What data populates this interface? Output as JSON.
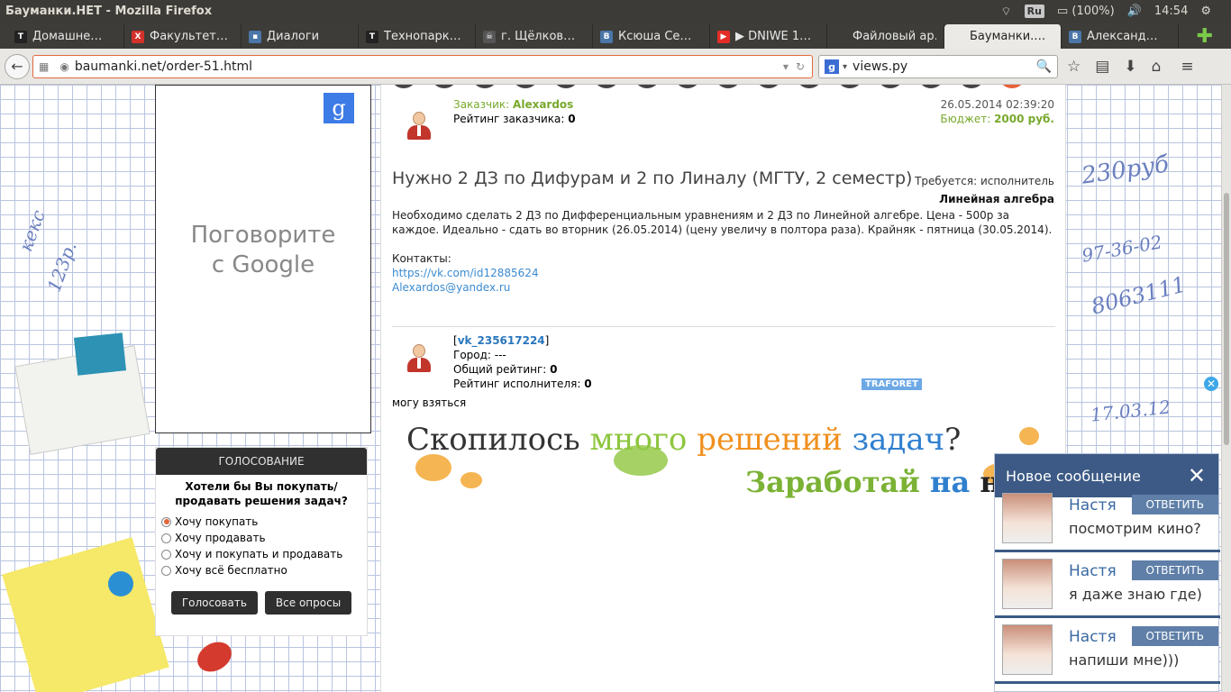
{
  "window": {
    "title": "Бауманки.НЕТ - Mozilla Firefox"
  },
  "tray": {
    "lang": "Ru",
    "battery": "(100%)",
    "time": "14:54"
  },
  "tabs": [
    {
      "label": "Домашне…",
      "fav": "T",
      "color": "#222222"
    },
    {
      "label": "Факультет…",
      "fav": "X",
      "color": "#d4312a"
    },
    {
      "label": "Диалоги",
      "fav": "▪",
      "color": "#4a76a8"
    },
    {
      "label": "Технопарк…",
      "fav": "T",
      "color": "#222222"
    },
    {
      "label": "г. Щёлков…",
      "fav": "☠",
      "color": "#555555"
    },
    {
      "label": "Ксюша Се…",
      "fav": "B",
      "color": "#4a76a8"
    },
    {
      "label": "▶ DNIWE 1…",
      "fav": "▶",
      "color": "#e52d27"
    },
    {
      "label": "Файловый ар…",
      "fav": "",
      "color": "#3d3c38"
    },
    {
      "label": "Бауманки.…",
      "fav": "",
      "color": "#eceae6"
    },
    {
      "label": "Александ…",
      "fav": "B",
      "color": "#4a76a8"
    }
  ],
  "nav": {
    "url": "baumanki.net/order-51.html",
    "search": "views.py"
  },
  "ad": {
    "line1": "Поговорите",
    "line2": "с Google"
  },
  "poll": {
    "header": "ГОЛОСОВАНИЕ",
    "question": "Хотели бы Вы покупать/продавать решения задач?",
    "options": [
      "Хочу покупать",
      "Хочу продавать",
      "Хочу и покупать и продавать",
      "Хочу всё бесплатно"
    ],
    "vote": "Голосовать",
    "all": "Все опросы"
  },
  "order": {
    "customer_label": "Заказчик:",
    "customer": "Alexardos",
    "rating_label": "Рейтинг заказчика:",
    "rating": "0",
    "date": "26.05.2014 02:39:20",
    "budget_label": "Бюджет:",
    "budget": "2000 руб.",
    "title": "Нужно 2 ДЗ по Дифурам и 2 по Линалу (МГТУ, 2 семестр)",
    "required": "Требуется: исполнитель",
    "subject": "Линейная алгебра",
    "desc": "Необходимо сделать 2 ДЗ по Дифференциальным уравнениям и 2 ДЗ по Линейной алгебре. Цена - 500р за каждое. Идеально - сдать во вторник (26.05.2014) (цену увеличу в полтора раза). Крайняк - пятница (30.05.2014).",
    "contacts_label": "Контакты:",
    "link1": "https://vk.com/id12885624",
    "link2": "Alexardos@yandex.ru"
  },
  "executor": {
    "name": "vk_235617224",
    "city": "Город: ---",
    "total_label": "Общий рейтинг:",
    "total": "0",
    "exec_label": "Рейтинг исполнителя:",
    "exec": "0",
    "comment": "могу взяться"
  },
  "banner": {
    "w1": "Скопилось",
    "w2": "много",
    "w3": "решений",
    "w4": "задач",
    "q": "?",
    "l2a": "Заработай",
    "l2b": "на",
    "l2c": "ни"
  },
  "traforet": "TRAFORET",
  "chat": {
    "title": "Новое сообщение",
    "messages": [
      {
        "name": "Настя",
        "text": "посмотрим кино?",
        "reply": "ОТВЕТИТЬ"
      },
      {
        "name": "Настя",
        "text": "я даже знаю где)",
        "reply": "ОТВЕТИТЬ"
      },
      {
        "name": "Настя",
        "text": "напиши мне)))",
        "reply": "ОТВЕТИТЬ"
      }
    ]
  },
  "handwriting": {
    "left1": "кекс",
    "left2": "123р.",
    "right1": "230руб",
    "right2": "97-36-02",
    "right3": "8063111",
    "right4": "17.03.12"
  }
}
